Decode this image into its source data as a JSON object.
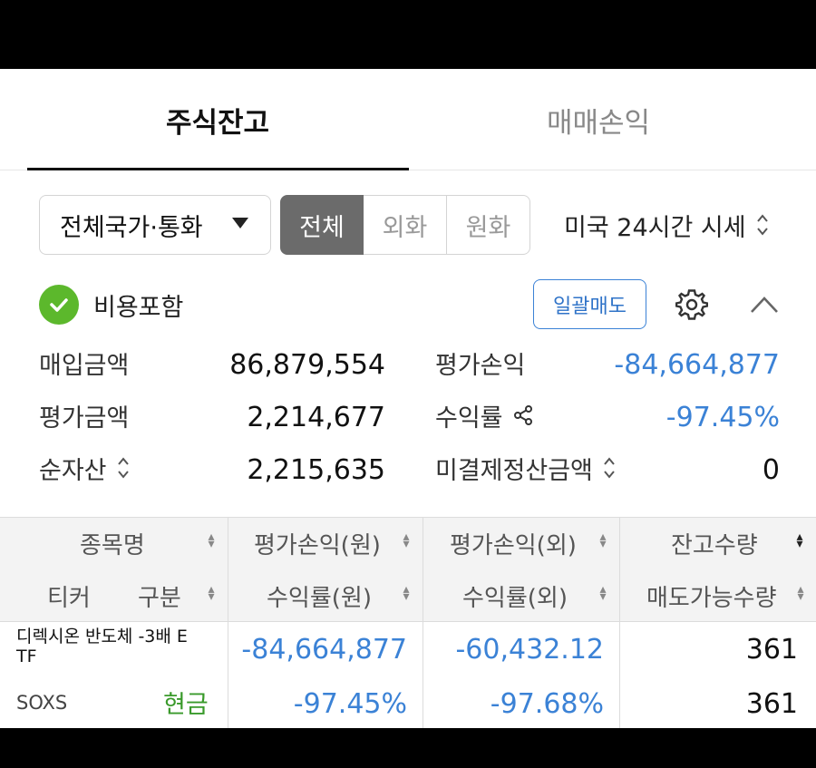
{
  "tabs": {
    "active": "주식잔고",
    "inactive": "매매손익"
  },
  "filters": {
    "country_currency": "전체국가·통화",
    "segments": [
      "전체",
      "외화",
      "원화"
    ],
    "us_quote": "미국 24시간 시세"
  },
  "options": {
    "include_fees_label": "비용포함",
    "bulk_sell_label": "일괄매도"
  },
  "summary": {
    "purchase_amount_label": "매입금액",
    "purchase_amount": "86,879,554",
    "valuation_pl_label": "평가손익",
    "valuation_pl": "-84,664,877",
    "valuation_amount_label": "평가금액",
    "valuation_amount": "2,214,677",
    "return_rate_label": "수익률",
    "return_rate": "-97.45%",
    "net_assets_label": "순자산",
    "net_assets": "2,215,635",
    "unsettled_label": "미결제정산금액",
    "unsettled": "0"
  },
  "table": {
    "headers": {
      "col1_top": "종목명",
      "col1_bottom_left": "티커",
      "col1_bottom_right": "구분",
      "col2_top": "평가손익(원)",
      "col2_bottom": "수익률(원)",
      "col3_top": "평가손익(외)",
      "col3_bottom": "수익률(외)",
      "col4_top": "잔고수량",
      "col4_bottom": "매도가능수량"
    },
    "rows": [
      {
        "name_line1": "디렉시온 반도체 -3배 E",
        "name_line2": "TF",
        "ticker": "SOXS",
        "type": "현금",
        "pl_krw": "-84,664,877",
        "pl_foreign": "-60,432.12",
        "qty": "361",
        "rate_krw": "-97.45%",
        "rate_foreign": "-97.68%",
        "sellable_qty": "361"
      }
    ]
  },
  "colors": {
    "accent_blue": "#3b82d6",
    "green": "#5cb82c",
    "selected_segment": "#6b6b6b"
  }
}
